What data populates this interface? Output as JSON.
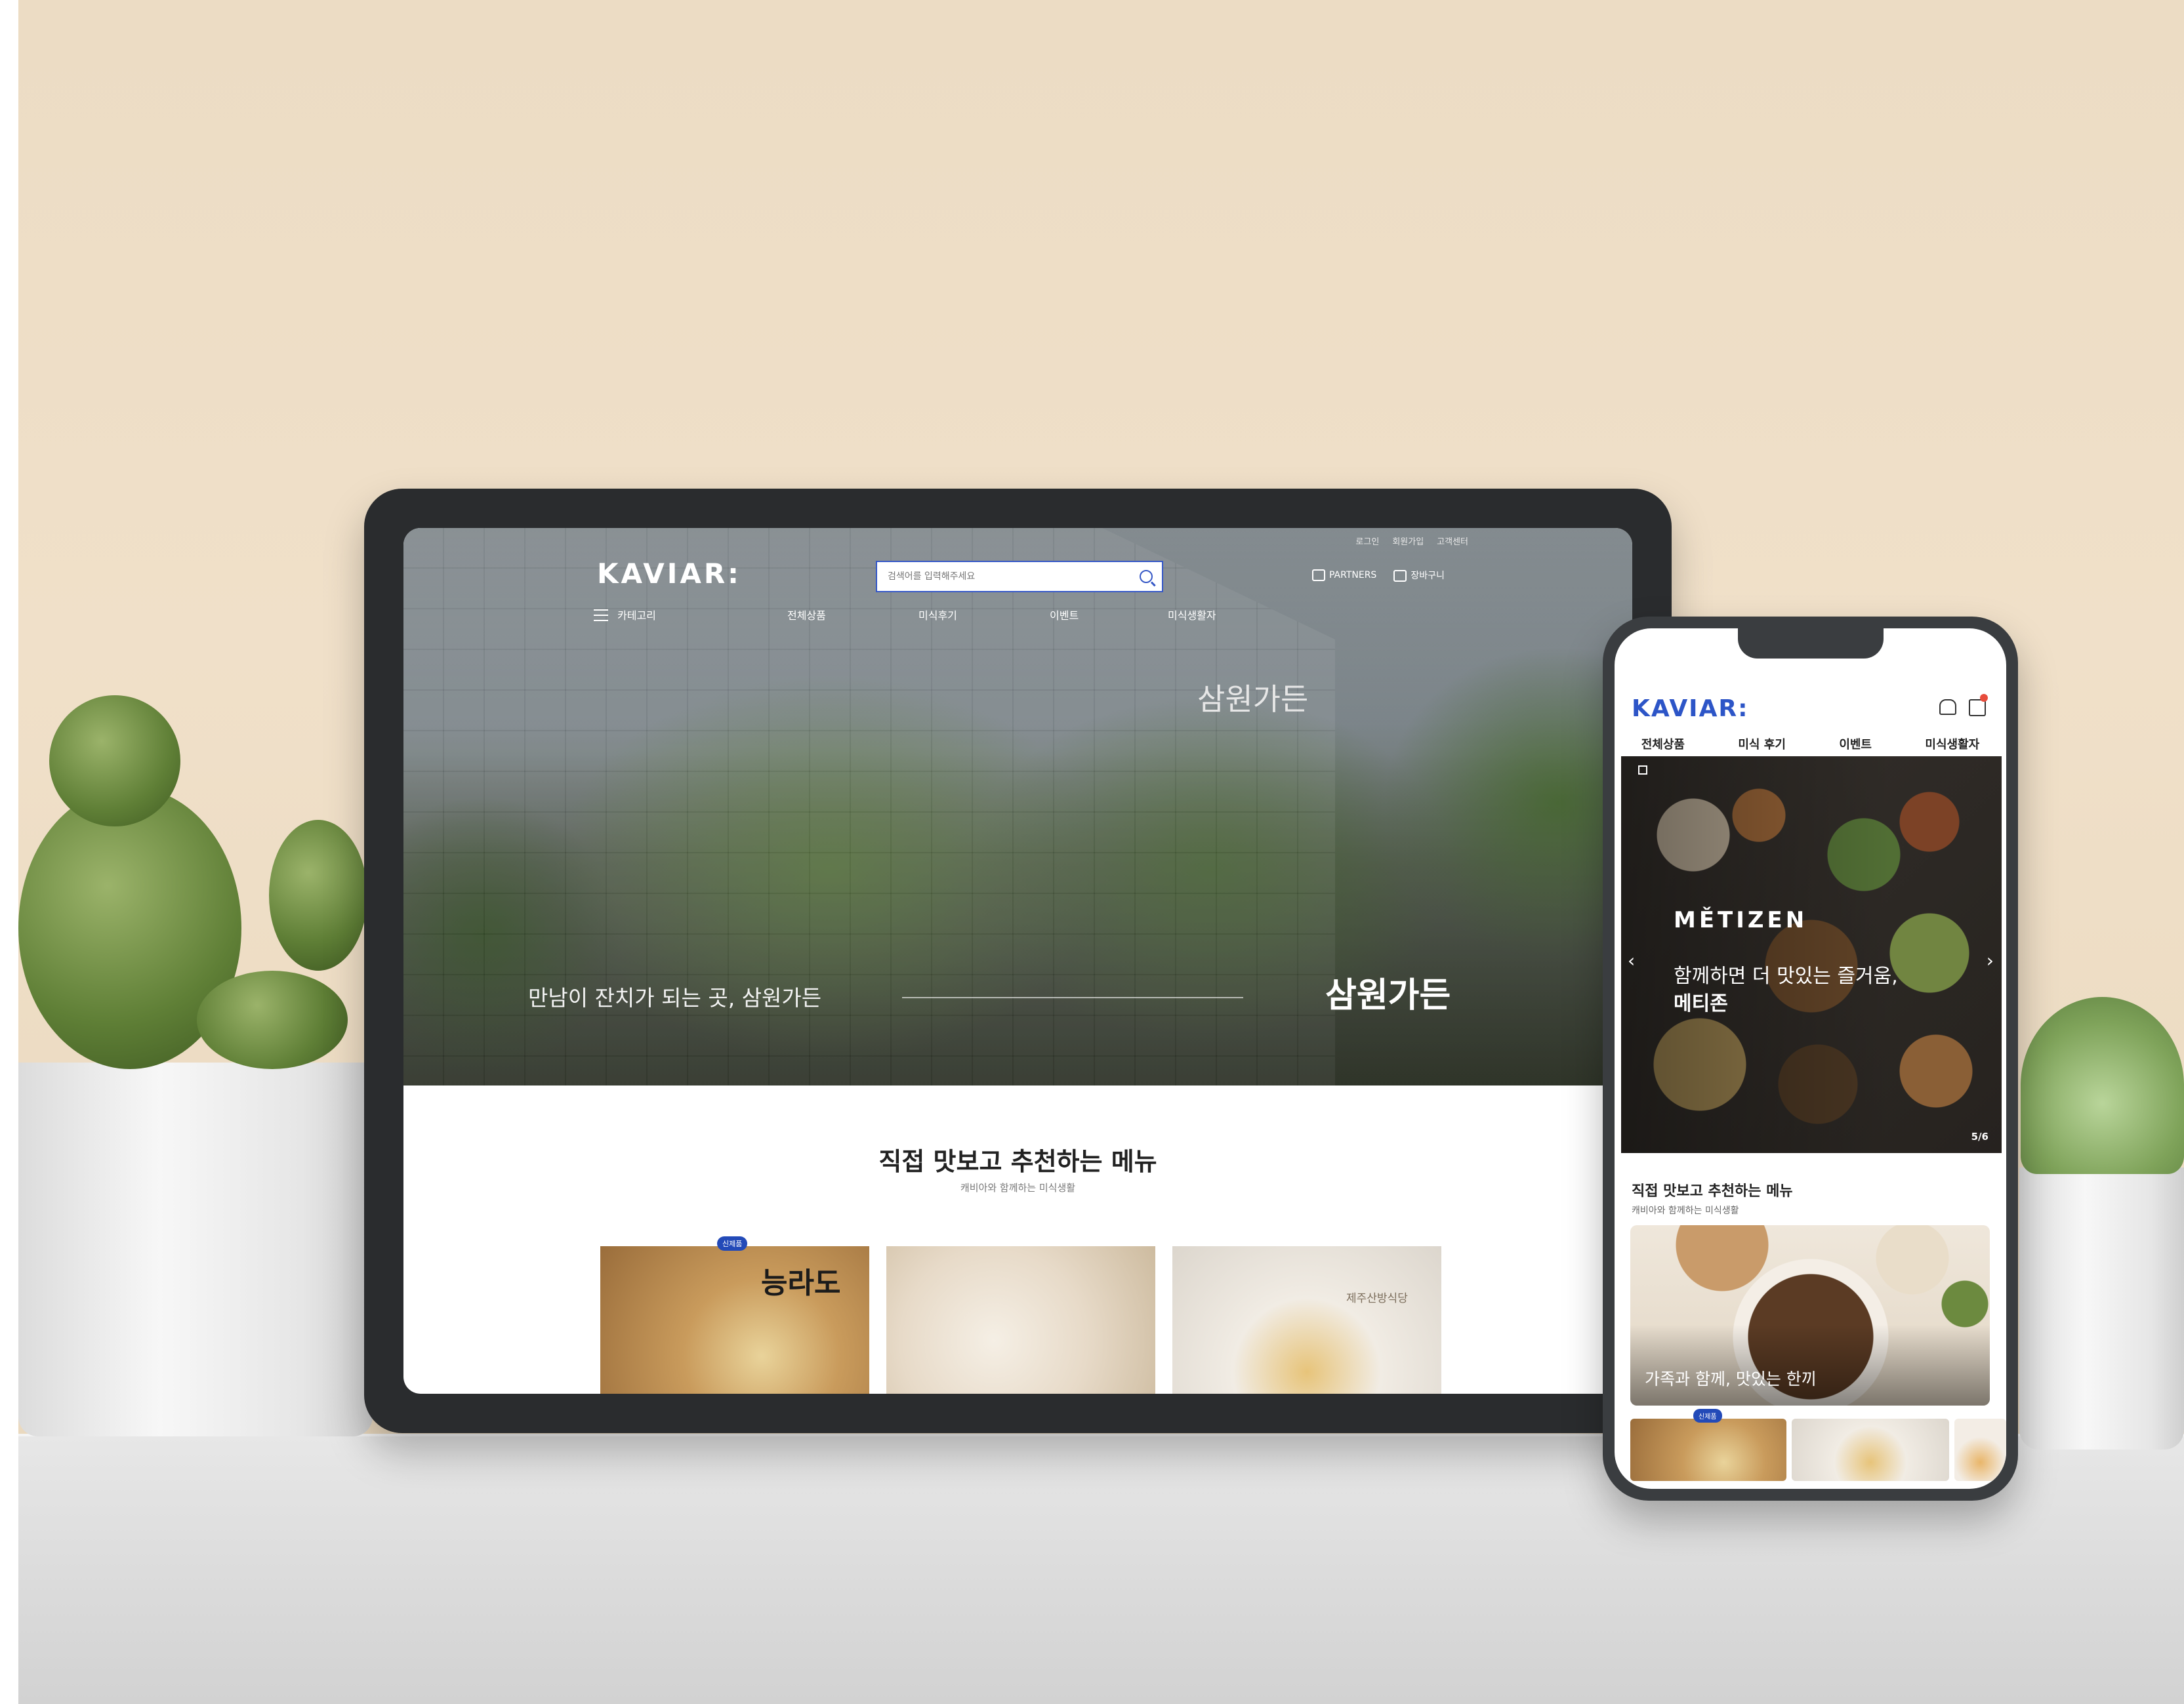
{
  "tablet": {
    "utility": [
      "로그인",
      "회원가입",
      "고객센터"
    ],
    "logo": "KAVIAR:",
    "search_placeholder": "검색어를 입력해주세요",
    "partners": "PARTNERS",
    "cart": "장바구니",
    "nav": [
      "카테고리",
      "전체상품",
      "미식후기",
      "이벤트",
      "미식생활자"
    ],
    "hero": {
      "text": "만남이 잔치가 되는 곳, 삼원가든",
      "brand": "삼원가든",
      "sign": "삼원가든"
    },
    "section": {
      "title": "직접 맛보고 추천하는 메뉴",
      "subtitle": "캐비아와 함께하는 미식생활"
    },
    "cards": [
      {
        "badge": "신제품",
        "logo": "능라도"
      },
      {},
      {
        "logo": "제주산방식당"
      }
    ]
  },
  "phone": {
    "logo": "KAVIAR:",
    "nav": [
      "전체상품",
      "미식 후기",
      "이벤트",
      "미식생활자"
    ],
    "hero": {
      "brand": "MĚTIZEN",
      "line1": "함께하면 더 맛있는 즐거움,",
      "line2": "메티존",
      "counter": "5/6"
    },
    "section": {
      "title": "직접 맛보고 추천하는 메뉴",
      "subtitle": "캐비아와 함께하는 미식생활"
    },
    "feature_text": "가족과 함께, 맛있는 한끼",
    "thumb_badge": "신제품"
  }
}
